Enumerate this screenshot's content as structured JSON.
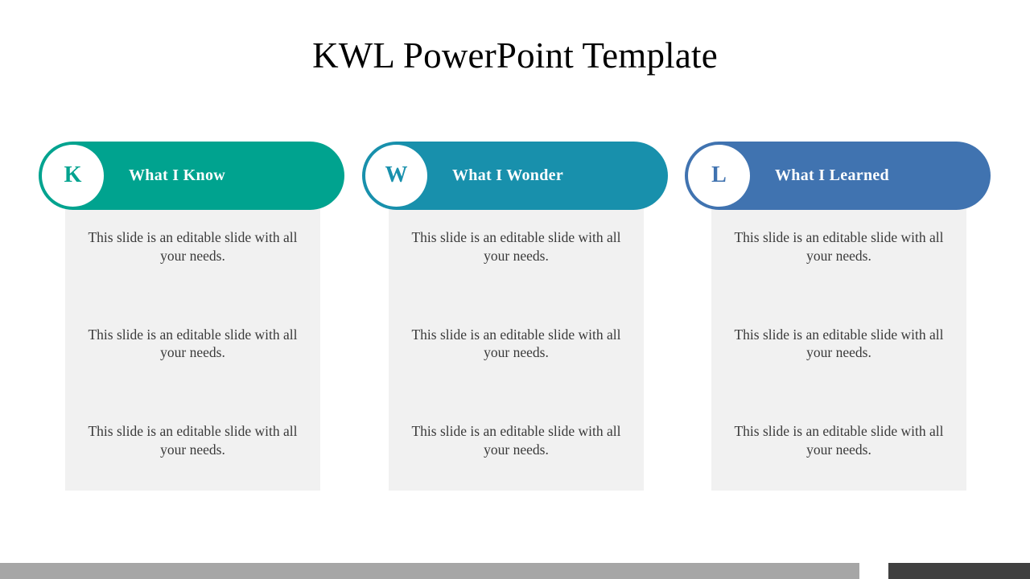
{
  "slide": {
    "title": "KWL PowerPoint Template",
    "background_color": "#FFFFFF"
  },
  "columns": [
    {
      "letter": "K",
      "heading": "What I Know",
      "accent_color": "#00A38F",
      "badge_text_color": "#00A38F",
      "panel_color": "#F1F1F1",
      "lines": [
        "This slide is an editable slide with all your needs.",
        "This slide is an editable slide with all your needs.",
        "This slide is an editable slide with all your needs."
      ]
    },
    {
      "letter": "W",
      "heading": "What I Wonder",
      "accent_color": "#1890AC",
      "badge_text_color": "#1890AC",
      "panel_color": "#F1F1F1",
      "lines": [
        "This slide is an editable slide with all your needs.",
        "This slide is an editable slide with all your needs.",
        "This slide is an editable slide with all your needs."
      ]
    },
    {
      "letter": "L",
      "heading": "What I Learned",
      "accent_color": "#4073B0",
      "badge_text_color": "#4073B0",
      "panel_color": "#F1F1F1",
      "lines": [
        "This slide is an editable slide with all your needs.",
        "This slide is an editable slide with all your needs.",
        "This slide is an editable slide with all your needs."
      ]
    }
  ],
  "footer": {
    "left_bar_color": "#A6A6A6",
    "right_bar_color": "#404040"
  }
}
